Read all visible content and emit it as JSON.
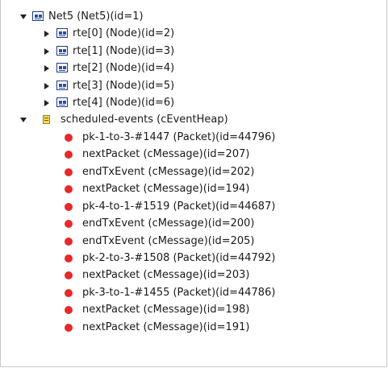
{
  "tree": {
    "root": {
      "label": "Net5 (Net5)(id=1)",
      "icon": "network-icon",
      "expanded": true,
      "children": [
        {
          "label": "rte[0] (Node)(id=2)",
          "icon": "network-icon",
          "expanded": false
        },
        {
          "label": "rte[1] (Node)(id=3)",
          "icon": "network-icon",
          "expanded": false
        },
        {
          "label": "rte[2] (Node)(id=4)",
          "icon": "network-icon",
          "expanded": false
        },
        {
          "label": "rte[3] (Node)(id=5)",
          "icon": "network-icon",
          "expanded": false
        },
        {
          "label": "rte[4] (Node)(id=6)",
          "icon": "network-icon",
          "expanded": false
        }
      ]
    },
    "scheduled": {
      "label": "scheduled-events (cEventHeap)",
      "icon": "event-heap-icon",
      "expanded": true,
      "events": [
        {
          "label": "pk-1-to-3-#1447 (Packet)(id=44796)",
          "icon": "red-dot-icon"
        },
        {
          "label": "nextPacket (cMessage)(id=207)",
          "icon": "red-dot-icon"
        },
        {
          "label": "endTxEvent (cMessage)(id=202)",
          "icon": "red-dot-icon"
        },
        {
          "label": "nextPacket (cMessage)(id=194)",
          "icon": "red-dot-icon"
        },
        {
          "label": "pk-4-to-1-#1519 (Packet)(id=44687)",
          "icon": "red-dot-icon"
        },
        {
          "label": "endTxEvent (cMessage)(id=200)",
          "icon": "red-dot-icon"
        },
        {
          "label": "endTxEvent (cMessage)(id=205)",
          "icon": "red-dot-icon"
        },
        {
          "label": "pk-2-to-3-#1508 (Packet)(id=44792)",
          "icon": "red-dot-icon"
        },
        {
          "label": "nextPacket (cMessage)(id=203)",
          "icon": "red-dot-icon"
        },
        {
          "label": "pk-3-to-1-#1455 (Packet)(id=44786)",
          "icon": "red-dot-icon"
        },
        {
          "label": "nextPacket (cMessage)(id=198)",
          "icon": "red-dot-icon"
        },
        {
          "label": "nextPacket (cMessage)(id=191)",
          "icon": "red-dot-icon"
        }
      ]
    }
  },
  "colors": {
    "event_dot": "#e8282a",
    "network_icon": "#2d4fa8",
    "heap_icon": "#ffd95a"
  }
}
